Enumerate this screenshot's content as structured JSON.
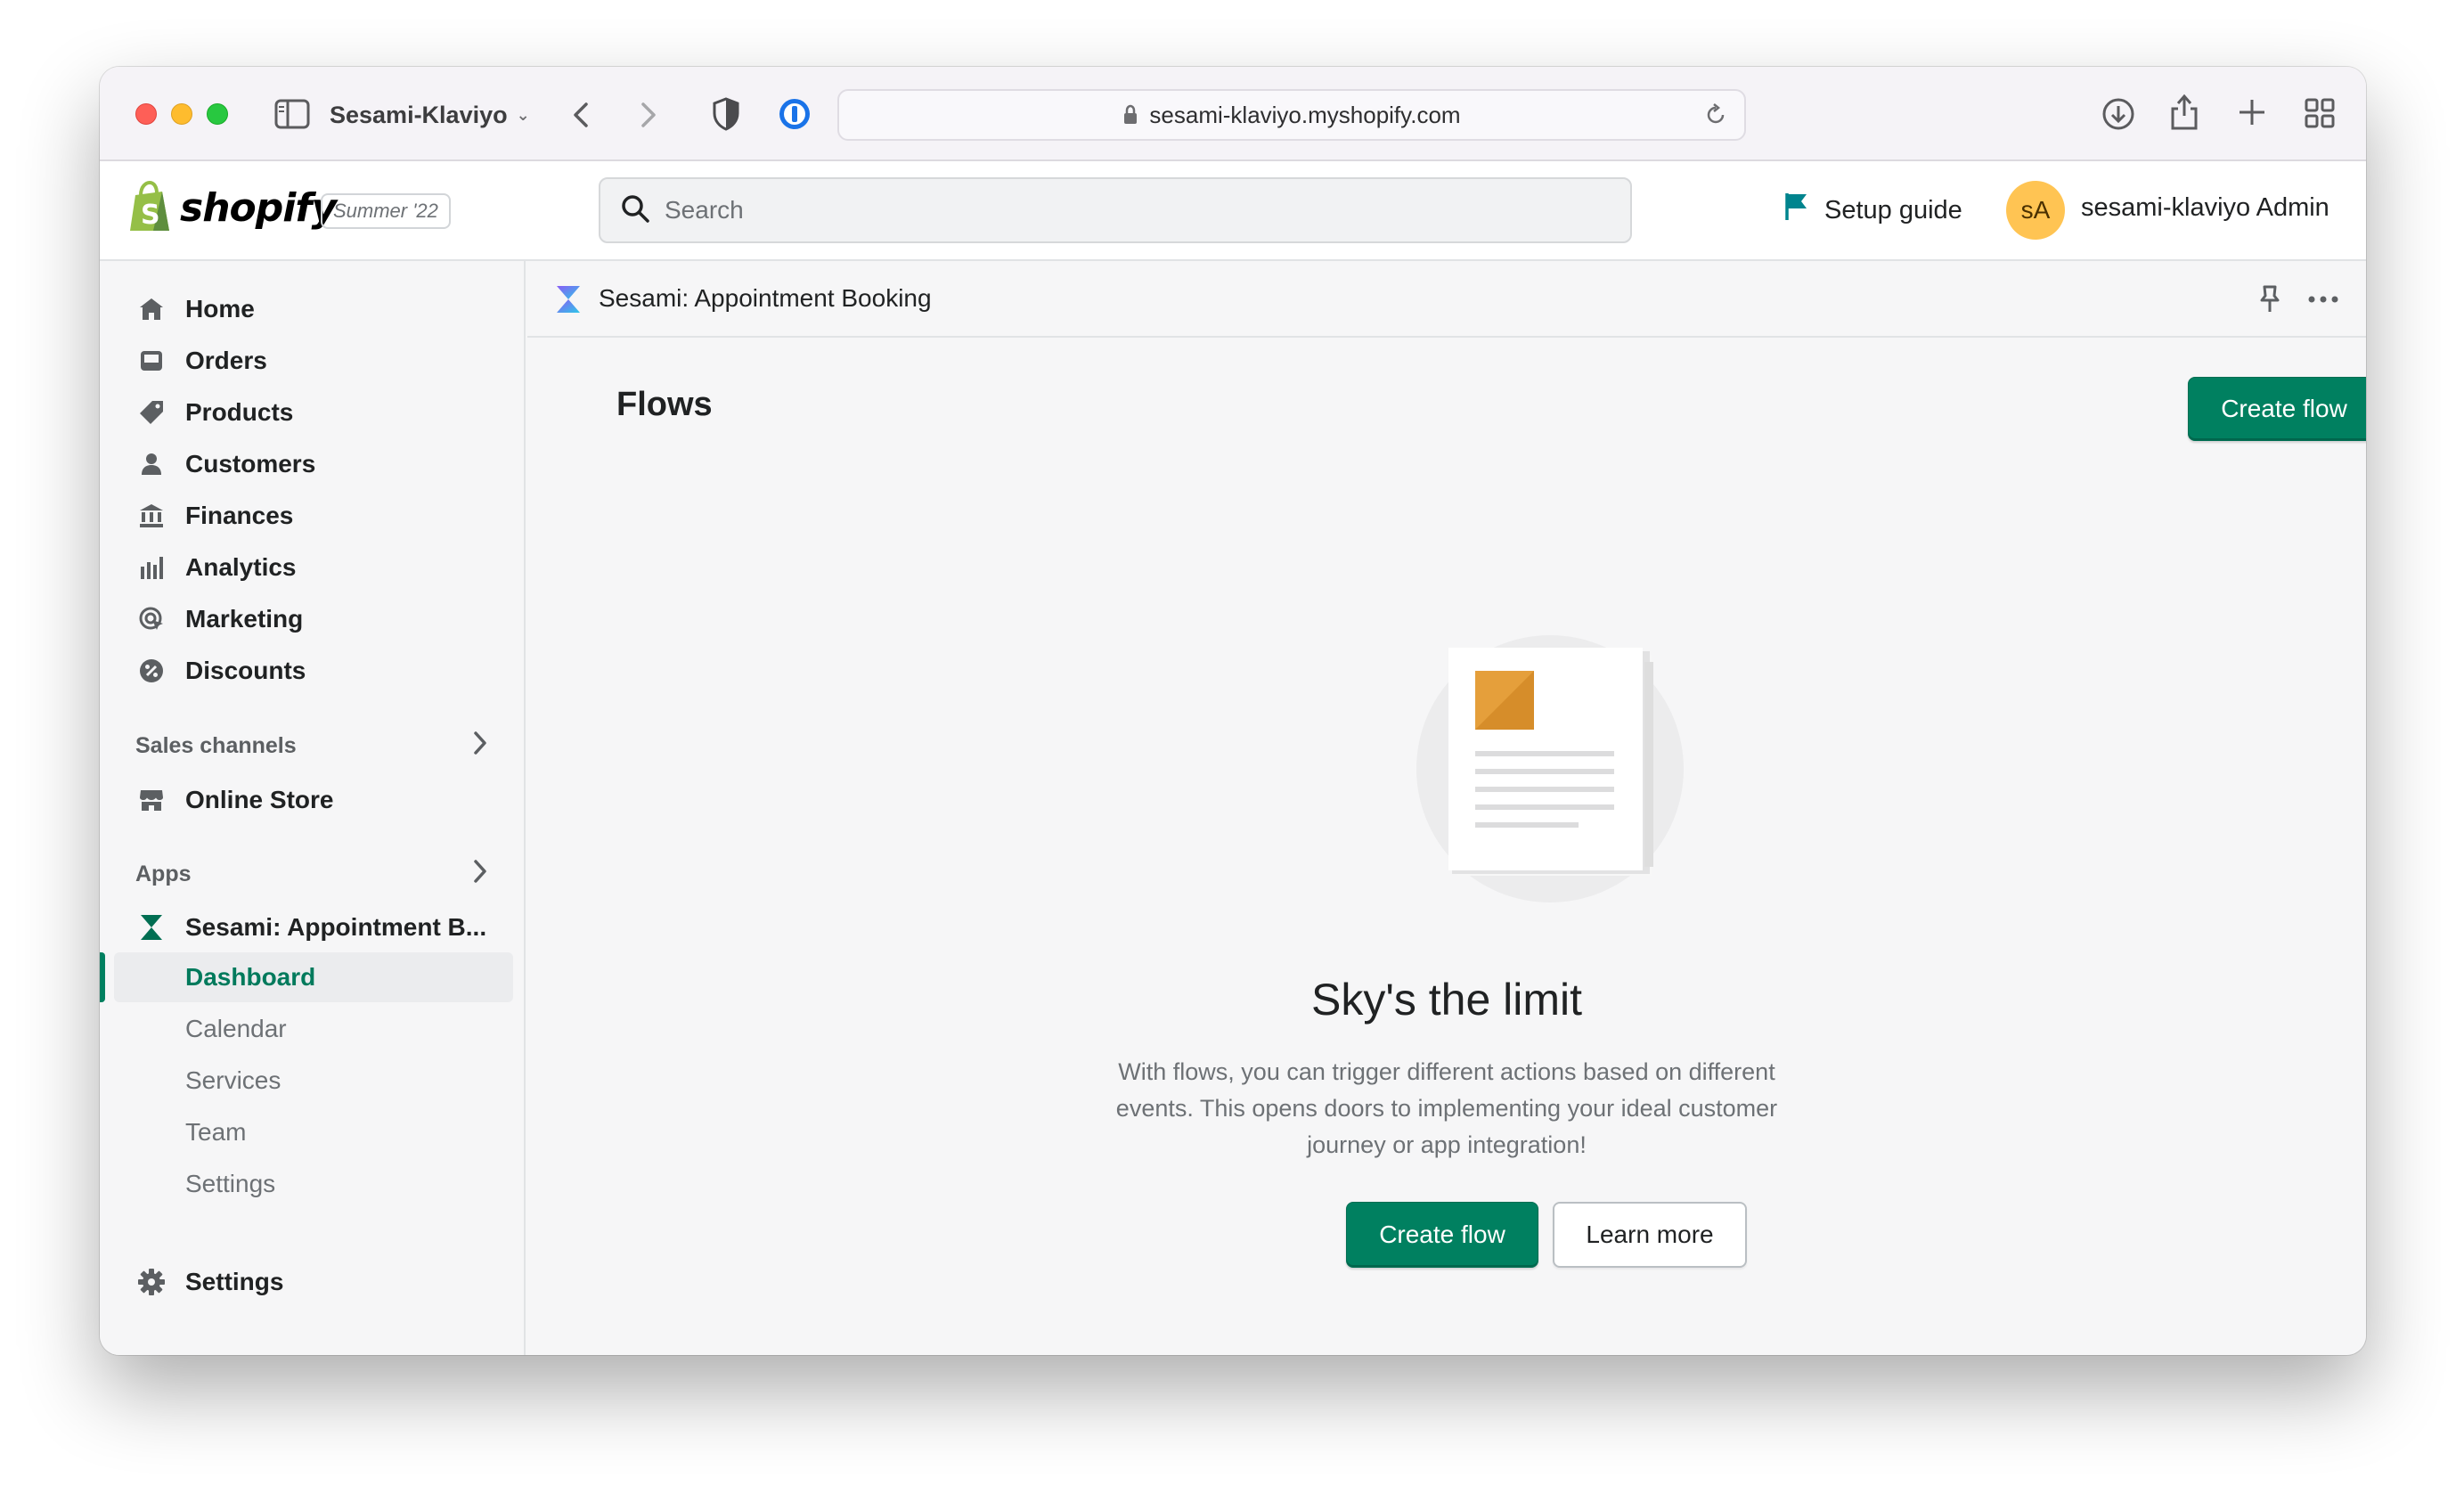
{
  "browser": {
    "tab_group": "Sesami-Klaviyo",
    "url": "sesami-klaviyo.myshopify.com"
  },
  "topbar": {
    "brand": "shopify",
    "edition": "Summer '22",
    "search_placeholder": "Search",
    "setup_guide": "Setup guide",
    "avatar_initials": "sA",
    "account_name": "sesami-klaviyo Admin"
  },
  "sidebar": {
    "items": [
      {
        "label": "Home",
        "icon": "home-icon"
      },
      {
        "label": "Orders",
        "icon": "orders-icon"
      },
      {
        "label": "Products",
        "icon": "tag-icon"
      },
      {
        "label": "Customers",
        "icon": "person-icon"
      },
      {
        "label": "Finances",
        "icon": "bank-icon"
      },
      {
        "label": "Analytics",
        "icon": "bar-chart-icon"
      },
      {
        "label": "Marketing",
        "icon": "target-icon"
      },
      {
        "label": "Discounts",
        "icon": "discount-icon"
      }
    ],
    "sales_channels_title": "Sales channels",
    "online_store": "Online Store",
    "apps_title": "Apps",
    "app_name": "Sesami: Appointment B...",
    "app_subitems": [
      {
        "label": "Dashboard",
        "active": true
      },
      {
        "label": "Calendar",
        "active": false
      },
      {
        "label": "Services",
        "active": false
      },
      {
        "label": "Team",
        "active": false
      },
      {
        "label": "Settings",
        "active": false
      }
    ],
    "settings": "Settings"
  },
  "main": {
    "app_title": "Sesami: Appointment Booking",
    "page_title": "Flows",
    "create_flow_top": "Create flow",
    "empty_state": {
      "title": "Sky's the limit",
      "body": "With flows, you can trigger different actions based on different events. This opens doors to implementing your ideal customer journey or app integration!",
      "primary_action": "Create flow",
      "secondary_action": "Learn more"
    }
  },
  "colors": {
    "primary": "#008060",
    "accent_yellow": "#ffc453",
    "text": "#202223",
    "subdued": "#6d7175"
  }
}
